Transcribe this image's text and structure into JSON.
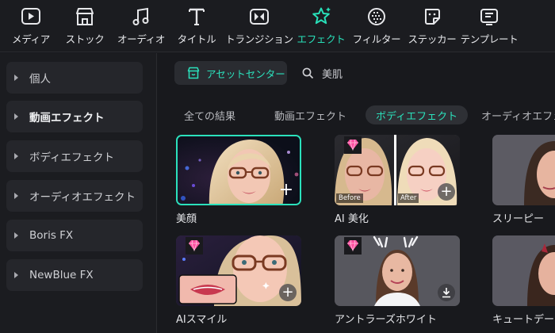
{
  "toolbar": {
    "items": [
      {
        "label": "メディア",
        "icon": "media-play-icon"
      },
      {
        "label": "ストック",
        "icon": "stock-store-icon"
      },
      {
        "label": "オーディオ",
        "icon": "music-note-icon"
      },
      {
        "label": "タイトル",
        "icon": "title-t-icon"
      },
      {
        "label": "トランジション",
        "icon": "transition-icon"
      },
      {
        "label": "エフェクト",
        "icon": "effect-star-icon",
        "active": true
      },
      {
        "label": "フィルター",
        "icon": "filter-icon"
      },
      {
        "label": "ステッカー",
        "icon": "sticker-icon"
      },
      {
        "label": "テンプレート",
        "icon": "template-icon"
      }
    ],
    "accent": "#28e0b9"
  },
  "sidebar": {
    "items": [
      {
        "label": "個人"
      },
      {
        "label": "動画エフェクト",
        "bold": true
      },
      {
        "label": "ボディエフェクト"
      },
      {
        "label": "オーディオエフェクト"
      },
      {
        "label": "Boris FX"
      },
      {
        "label": "NewBlue FX"
      }
    ]
  },
  "main": {
    "asset_center": "アセットセンター",
    "search_value": "美肌",
    "tabs": [
      {
        "label": "全ての結果"
      },
      {
        "label": "動画エフェクト"
      },
      {
        "label": "ボディエフェクト",
        "active": true
      },
      {
        "label": "オーディオエフェク"
      }
    ],
    "cards": [
      {
        "label": "美顔",
        "premium": false,
        "selected": true
      },
      {
        "label": "AI 美化",
        "premium": true,
        "before": "Before",
        "after": "After"
      },
      {
        "label": "スリーピー",
        "premium": false
      },
      {
        "label": "AIスマイル",
        "premium": true
      },
      {
        "label": "アントラーズホワイト",
        "premium": true
      },
      {
        "label": "キュートデーモン",
        "premium": false
      }
    ]
  }
}
